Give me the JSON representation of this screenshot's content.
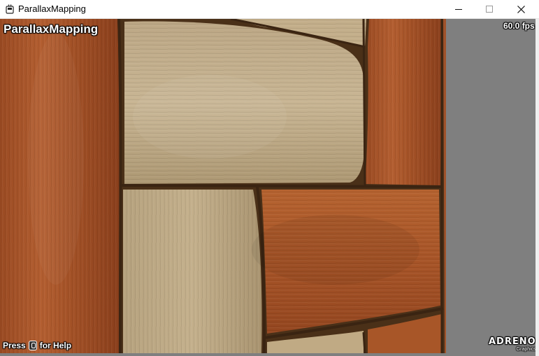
{
  "window": {
    "title": "ParallaxMapping",
    "icon": "app-icon",
    "buttons": {
      "minimize": "minimize-icon",
      "maximize": "maximize-icon",
      "close": "close-icon"
    }
  },
  "overlay": {
    "app_name": "ParallaxMapping",
    "fps": "60.0 fps",
    "help_prefix": "Press",
    "help_suffix": "for Help",
    "brand_name": "ADRENO",
    "brand_sub": "Graphics"
  },
  "colors": {
    "client_background": "#7f7f7f",
    "wood_dark": "#a8532a",
    "wood_light": "#b79f7a",
    "groove": "#4a3018"
  }
}
